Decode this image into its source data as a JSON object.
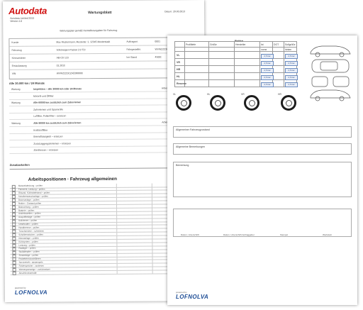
{
  "back_sheet": {
    "logo": "Autodata",
    "logo_sub": [
      "Autodata Limited 2013",
      "Version 1.0"
    ],
    "title": "Wartungsblatt",
    "date": "Datum: 20.03.2013",
    "note": "Wartungsplan gemäß Herstellerangaben für Fahrzeug",
    "info_rows": [
      {
        "label": "Kunde",
        "value": "Max Mustermann, Musterstr. 1, 12345 Musterstadt",
        "label2": "Auftragsnr.",
        "value2": "0001"
      },
      {
        "label": "Fahrzeug",
        "value": "Volkswagen Passat 2.0 TDI",
        "label2": "Fahrgestellnr.",
        "value2": "WVWZZZ3CZ"
      },
      {
        "label": "Kennzeichen",
        "value": "AB-CD 123",
        "label2": "km-Stand",
        "value2": "45000"
      },
      {
        "label": "Erstzulassung",
        "value": "01.2010",
        "label2": "",
        "value2": ""
      },
      {
        "label": "VIN",
        "value": "WVWZZZ3CZAE000000",
        "label2": "",
        "value2": ""
      }
    ],
    "inspection_title": "Alle 30.000 km / 24 Monate",
    "inspection_rows": [
      {
        "tag": "Wartung",
        "text": "Inspektion – alle 30000 km oder 24 Monate",
        "right": "Arbeitswert"
      },
      {
        "tag": "",
        "text": "Motoröl und Ölfilter",
        "right": ""
      },
      {
        "tag": "Wartung",
        "text": "Alle 60000 km zusätzlich zum Zahnriemen",
        "right": ""
      },
      {
        "tag": "",
        "text": "Zahnriemen und Spannrolle",
        "right": ""
      },
      {
        "tag": "",
        "text": "Luftfilter, Pollenfilter – ersetzen",
        "right": ""
      },
      {
        "tag": "Wartung",
        "text": "Alle 90000 km zusätzlich zum Zahnriemen",
        "right": "Arbeitswert"
      },
      {
        "tag": "",
        "text": "Kraftstofffilter",
        "right": ""
      },
      {
        "tag": "",
        "text": "Bremsflüssigkeit – ersetzen",
        "right": ""
      },
      {
        "tag": "",
        "text": "Zusatzaggregateriemen – ersetzen",
        "right": ""
      },
      {
        "tag": "",
        "text": "Zündkerzen – ersetzen",
        "right": ""
      }
    ],
    "section_title": "Zusatzarbeiten",
    "work_heading": "Arbeitspositionen · Fahrzeug allgemeinen",
    "work_items": [
      "Motorabdeckung – prüfen",
      "Fahrwerk, Lenkung – prüfen",
      "Ölstand, Kühlmittelstand – prüfen",
      "Scheibenwaschanlage – prüfen",
      "Bremsanlage – prüfen",
      "Reifen – Zustand prüfen",
      "Beleuchtung – prüfen",
      "Batterie – prüfen",
      "Antriebswellen – prüfen",
      "Auspuffanlage – prüfen",
      "Keilriemen – prüfen",
      "Unterboden – prüfen",
      "Handbremse – prüfen",
      "Türscharniere – schmieren",
      "Scheibenwischer – prüfen",
      "Klimaanlage – prüfen",
      "Kühlsystem – prüfen",
      "Lenkung – prüfen",
      "Radlager – prüfen",
      "Stoßdämpfer – prüfen",
      "Zündanlage – prüfen",
      "Probefahrt durchführen",
      "Serviceheft – abstempeln",
      "Fehlerspeicher – auslesen",
      "Wartungsanzeige – zurücksetzen",
      "Abschlusskontrolle"
    ],
    "brand": "LOFNOLVA",
    "brand_sub": "powered by"
  },
  "front_sheet": {
    "table_title": "Reifen",
    "table_headers": [
      "",
      "Profiltiefe",
      "Größe",
      "Hersteller",
      "Ist",
      "DOT",
      "Sollgröße"
    ],
    "table_subheaders": [
      "",
      "",
      "",
      "",
      "vorne",
      "",
      "hinten"
    ],
    "table_rows": [
      "VL",
      "VR",
      "HR",
      "HL",
      "Reserve"
    ],
    "input_value": "2,5 bar",
    "tire_labels": [
      "VL",
      "HL",
      "VR",
      "HR"
    ],
    "box1_title": "Allgemeiner Fahrzeugzustand",
    "box2_title": "Allgemeine Bemerkungen",
    "box3_title": "Bemerkung",
    "footer_labels": [
      "Datum, Unterschrift",
      "Datum, Unterschrift Auftraggeber",
      "Stempel",
      "Werkstatt"
    ],
    "brand": "LOFNOLVA",
    "brand_sub": "powered by"
  }
}
